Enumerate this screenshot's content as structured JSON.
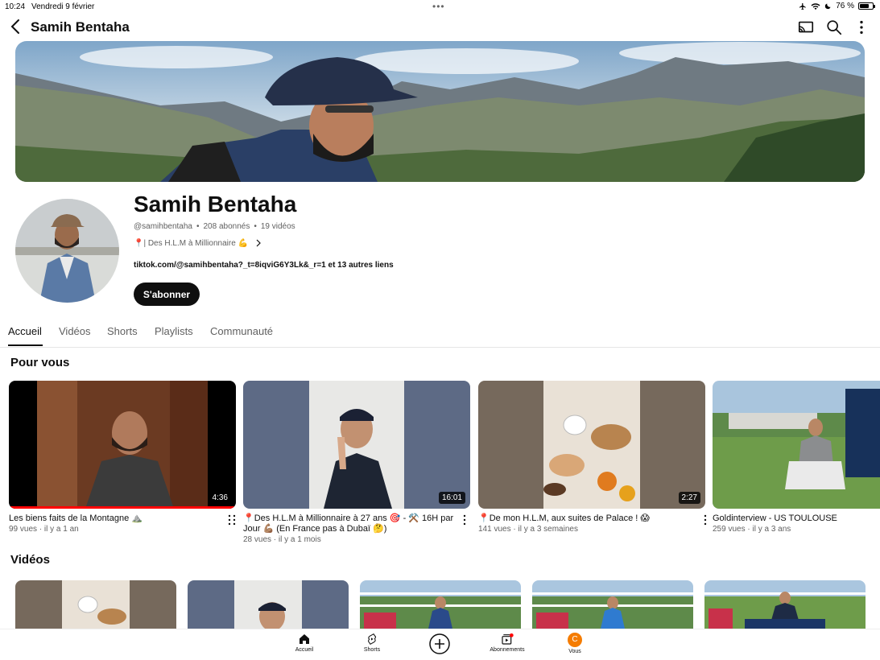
{
  "status_bar": {
    "time": "10:24",
    "date": "Vendredi 9 février",
    "battery": "76 %",
    "battery_level": 0.76
  },
  "header": {
    "title": "Samih Bentaha",
    "icons": [
      "back-arrow-icon",
      "cast-icon",
      "search-icon",
      "more-vertical-icon"
    ]
  },
  "channel": {
    "name": "Samih Bentaha",
    "handle": "@samihbentaha",
    "subscribers": "208 abonnés",
    "videos_count": "19 vidéos",
    "separator": "•",
    "description": "📍| Des H.L.M à Millionnaire 💪",
    "links": "tiktok.com/@samihbentaha?_t=8iqviG6Y3Lk&_r=1 et 13 autres liens",
    "subscribe_label": "S'abonner"
  },
  "tabs": [
    {
      "label": "Accueil",
      "active": true
    },
    {
      "label": "Vidéos",
      "active": false
    },
    {
      "label": "Shorts",
      "active": false
    },
    {
      "label": "Playlists",
      "active": false
    },
    {
      "label": "Communauté",
      "active": false
    }
  ],
  "sections": {
    "for_you": "Pour vous",
    "videos": "Vidéos"
  },
  "for_you_videos": [
    {
      "title": "Les biens faits de la Montagne ⛰️",
      "meta": "99 vues · il y a 1 an",
      "duration": "4:36",
      "watched": 1.0
    },
    {
      "title": "📍Des H.L.M à Millionnaire à 27 ans 🎯 - ⚒️ 16H par Jour 💪🏽 (En France pas à Dubaï 🤔)",
      "meta": "28 vues · il y a 1 mois",
      "duration": "16:01",
      "watched": 0
    },
    {
      "title": "📍De mon H.L.M, aux suites de Palace ! 😱",
      "meta": "141 vues · il y a 3 semaines",
      "duration": "2:27",
      "watched": 0
    },
    {
      "title": "Goldinterview - US TOULOUSE",
      "meta": "259 vues · il y a 3 ans",
      "duration": "",
      "watched": 0
    }
  ],
  "bottom_nav": [
    {
      "label": "Accueil",
      "icon": "home-icon"
    },
    {
      "label": "Shorts",
      "icon": "shorts-icon"
    },
    {
      "label": "",
      "icon": "create-icon"
    },
    {
      "label": "Abonnements",
      "icon": "subscriptions-icon"
    },
    {
      "label": "Vous",
      "icon": "you-avatar",
      "avatar_letter": "C"
    }
  ],
  "colors": {
    "accent_red": "#ff0000",
    "text_primary": "#0f0f0f",
    "text_secondary": "#606060",
    "avatar_orange": "#f57c00"
  }
}
